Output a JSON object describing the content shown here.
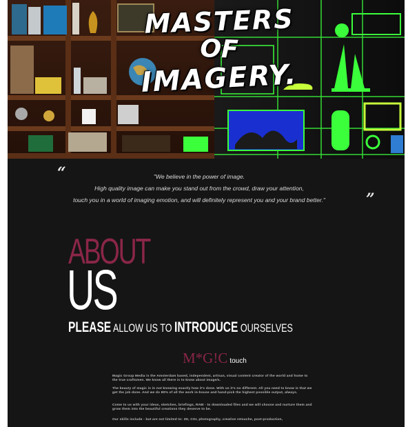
{
  "hero": {
    "title_line1": "MASTERS",
    "title_line2": "OF",
    "title_line3": "IMAGERY."
  },
  "quote": {
    "open_mark": "“",
    "close_mark": "”",
    "line1": "\"We believe in the power of image.",
    "line2": "High quality image can make you stand out from the crowd, draw your attention,",
    "line3": "touch you in a world of imaging emotion, and will definitely represent you and your brand better.\""
  },
  "about": {
    "word1": "ABOUT",
    "word2": "US",
    "intro_please": "PLEASE",
    "intro_allow": " ALLOW US TO ",
    "intro_introduce": "INTRODUCE",
    "intro_ourselves": " OURSELVES"
  },
  "magic": {
    "logo": "M*G!C",
    "touch": "touch"
  },
  "body": {
    "p1": "Magic Group Media is the Amsterdam based, independent, artisan, visual content creator of the world and home to the true craftsmen. We know all there is to know about image/s.",
    "p2": "The beauty of magic is in not knowing exactly how it's done. With us it's no different. All you need to know is that we get the job done. And we do 80% of all the work in-house and hand-pick the highest possible output, always.",
    "p3": "Come to us with your ideas, sketches, briefings, RAW - to downloaded files and we will choose and nurture them and grow them into the beautiful creations they deserve to be.",
    "p4": "Our skills include - but are not limited to: 3D, CGI, photography, creative retouche, post-production,"
  },
  "colors": {
    "background": "#151515",
    "accent": "#8a2648",
    "neon_green": "#3bff3b"
  }
}
